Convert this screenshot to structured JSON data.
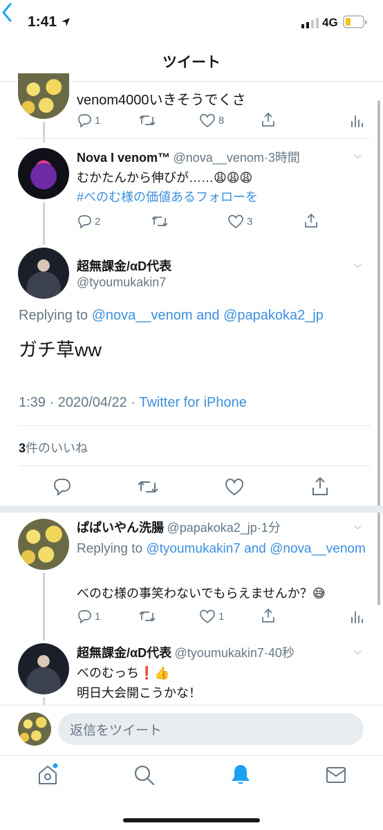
{
  "status": {
    "time": "1:41",
    "network": "4G"
  },
  "nav": {
    "title": "ツイート"
  },
  "tweet1": {
    "text": "venom4000いきそうでくさ",
    "reply_count": "1",
    "like_count": "8"
  },
  "tweet2": {
    "name": "Nova I venom™",
    "handle": "@nova__venom",
    "time": "·3時間",
    "text": "むかたんから伸びが……😩😩😩",
    "hashtag": "#べのむ様の価値あるフォローを",
    "reply_count": "2",
    "like_count": "3"
  },
  "main": {
    "name": "超無課金/αD代表",
    "handle": "@tyoumukakin7",
    "replying_prefix": "Replying to",
    "reply_to_1": "@nova__venom",
    "and": "and",
    "reply_to_2": "@papakoka2_jp",
    "text": "ガチ草ww",
    "datetime": "1:39 · 2020/04/22 ·",
    "client": "Twitter for iPhone",
    "likes_number": "3",
    "likes_label": "件のいいね"
  },
  "reply1": {
    "name": "ぱぱいやん洗腸",
    "handle": "@papakoka2_jp",
    "time": "·1分",
    "replying_prefix": "Replying to",
    "reply_to_1": "@tyoumukakin7",
    "and": "and",
    "reply_to_2": "@nova__venom",
    "text": "べのむ様の事笑わないでもらえませんか？😅",
    "reply_count": "1",
    "like_count": "1"
  },
  "reply2": {
    "name": "超無課金/αD代表",
    "handle": "@tyoumukakin7",
    "time": "·40秒",
    "line1": "べのむっち❗👍",
    "line2": "明日大会開こうかな！"
  },
  "composer": {
    "placeholder": "返信をツイート"
  },
  "colors": {
    "accent": "#3b8fdd",
    "text": "#14171a",
    "secondary": "#657786"
  }
}
